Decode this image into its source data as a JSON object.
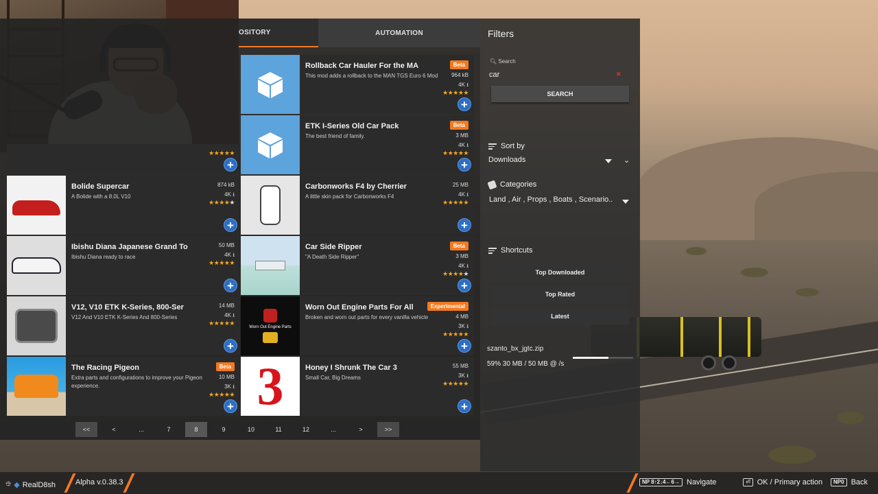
{
  "tabs": {
    "repository": "OSITORY",
    "automation": "AUTOMATION"
  },
  "mods": [
    {
      "title": "Rollback Car Hauler For the MA",
      "desc": "This mod adds a rollback to the MAN TGS Euro 6 Mod",
      "badge": "Beta",
      "size": "964 kB",
      "downloads": "4K",
      "rating": 5
    },
    {
      "title": "ETK I-Series Old Car Pack",
      "desc": "The best friend of family.",
      "badge": "Beta",
      "size": "3 MB",
      "downloads": "4K",
      "rating": 5
    },
    {
      "title": "Bolide Supercar",
      "desc": "A Bolide with a 8.0L V10",
      "badge": "",
      "size": "874 kB",
      "downloads": "4K",
      "rating": 4
    },
    {
      "title": "Carbonworks F4 by Cherrier",
      "desc": "A little skin pack for Carbonworks F4",
      "badge": "",
      "size": "25 MB",
      "downloads": "4K",
      "rating": 5
    },
    {
      "title": "Ibishu Diana Japanese Grand To",
      "desc": "Ibishu Diana ready to race",
      "badge": "",
      "size": "50 MB",
      "downloads": "4K",
      "rating": 5
    },
    {
      "title": "Car Side Ripper",
      "desc": "\"A Death Side Ripper\"",
      "badge": "Beta",
      "size": "3 MB",
      "downloads": "4K",
      "rating": 4
    },
    {
      "title": "V12, V10 ETK K-Series, 800-Ser",
      "desc": "V12 And V10 ETK K-Series And 800-Series",
      "badge": "",
      "size": "14 MB",
      "downloads": "4K",
      "rating": 5
    },
    {
      "title": "Worn Out Engine Parts For All",
      "desc": "Broken and worn out parts for every vanilla vehicle",
      "badge": "Experimental",
      "size": "4 MB",
      "downloads": "3K",
      "rating": 5
    },
    {
      "title": "The Racing Pigeon",
      "desc": "Extra parts and configurations to improve your Pigeon experience.",
      "badge": "Beta",
      "size": "10 MB",
      "downloads": "3K",
      "rating": 5
    },
    {
      "title": "Honey I Shrunk The Car 3",
      "desc": "Small Car, Big Dreams",
      "badge": "",
      "size": "55 MB",
      "downloads": "3K",
      "rating": 5
    }
  ],
  "thumb_text": {
    "worn_out": "Worn Out Engine Parts",
    "honey": "3"
  },
  "pagination": [
    "<<",
    "<",
    "...",
    "7",
    "8",
    "9",
    "10",
    "11",
    "12",
    "...",
    ">",
    ">>"
  ],
  "pagination_active": "8",
  "filters": {
    "title": "Filters",
    "search_label": "Search",
    "search_value": "car",
    "search_clear": "✖",
    "search_button": "SEARCH",
    "sort_title": "Sort by",
    "sort_value": "Downloads",
    "categories_title": "Categories",
    "categories_value": "Land , Air , Props , Boats , Scenario...",
    "shortcuts_title": "Shortcuts",
    "shortcuts": [
      "Top Downloaded",
      "Top Rated",
      "Latest"
    ]
  },
  "download": {
    "file": "szanto_bx_jgtc.zip",
    "status": "59% 30 MB / 50 MB @ /s",
    "progress": 0.59
  },
  "bottombar": {
    "user": "RealD8sh",
    "version": "Alpha v.0.38.3",
    "nav_key": "NP 8↑2↓4←6→",
    "nav_label": "Navigate",
    "ok_label": "OK / Primary action",
    "back_key": "NP0",
    "back_label": "Back"
  },
  "colors": {
    "accent": "#f47920",
    "add_button": "#2c6fc4",
    "star": "#f5a623",
    "box_thumb": "#5da3dc"
  },
  "icons": [
    "cube-icon",
    "plus-icon",
    "star-icon",
    "download-arrow-icon",
    "menu-icon",
    "tag-icon",
    "chevron-down-icon",
    "search-icon",
    "gamepad-icon"
  ]
}
